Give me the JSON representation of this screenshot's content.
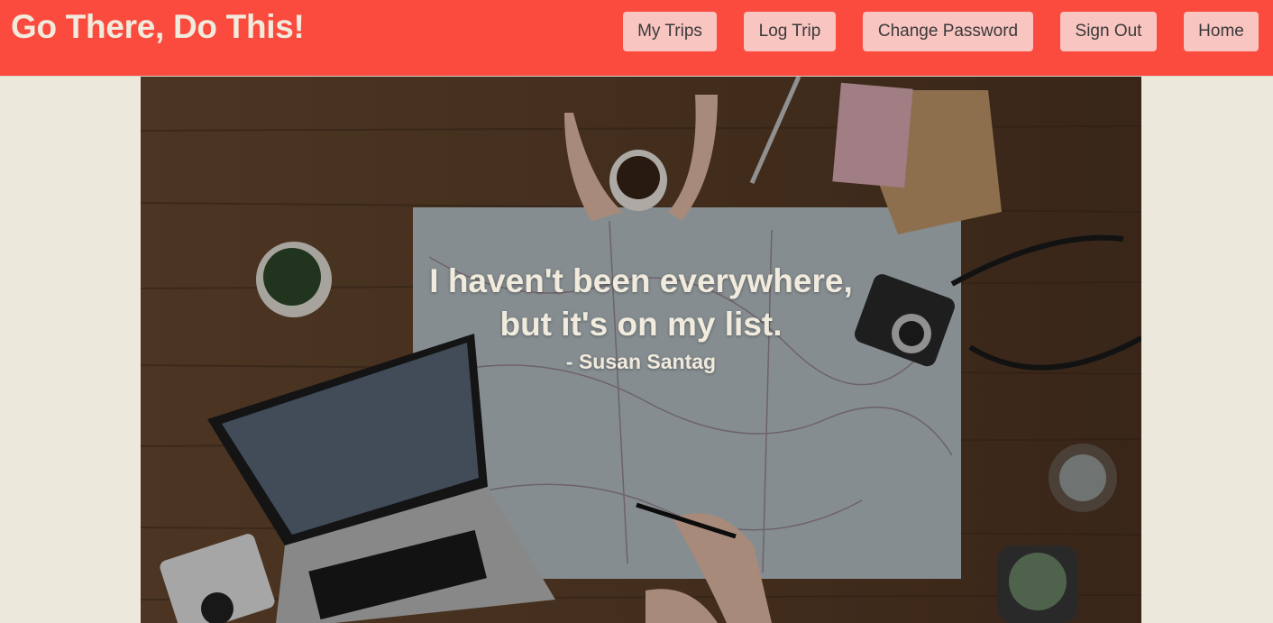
{
  "header": {
    "brand": "Go There, Do This!",
    "background_color": "#fb4a3e",
    "nav": [
      {
        "label": "My Trips",
        "name": "my-trips-button"
      },
      {
        "label": "Log Trip",
        "name": "log-trip-button"
      },
      {
        "label": "Change Password",
        "name": "change-password-button"
      },
      {
        "label": "Sign Out",
        "name": "sign-out-button"
      },
      {
        "label": "Home",
        "name": "home-button"
      }
    ]
  },
  "hero": {
    "quote_line_1": "I haven't been everywhere,",
    "quote_line_2": "but it's on my list.",
    "author": "- Susan Santag"
  },
  "colors": {
    "page_background": "#ece8dc",
    "button_background": "#f8c5c1",
    "text_light": "#f1ebdd"
  }
}
